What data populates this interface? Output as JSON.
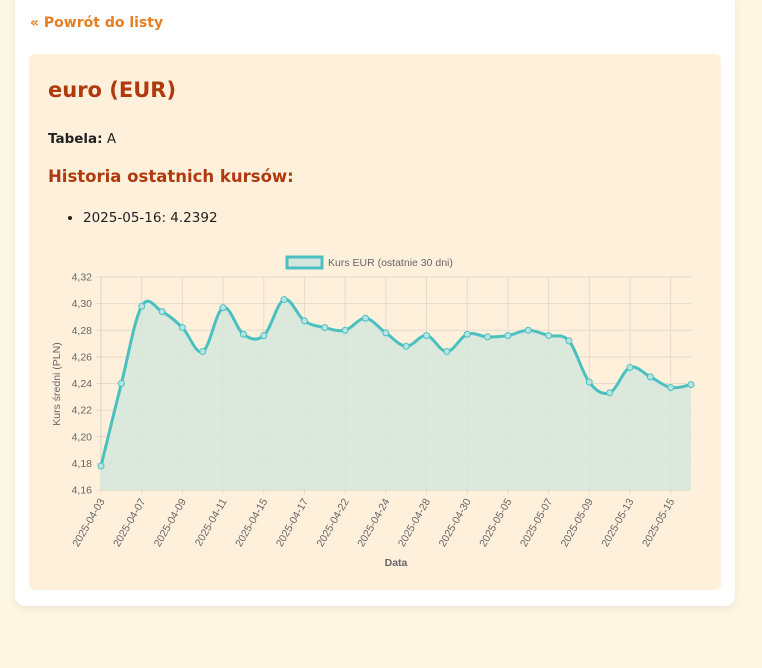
{
  "nav": {
    "back_label": "« Powrót do listy"
  },
  "currency": {
    "title": "euro (EUR)",
    "table_label": "Tabela:",
    "table_value": "A"
  },
  "history": {
    "title": "Historia ostatnich kursów:",
    "items": [
      "2025-05-16: 4.2392"
    ]
  },
  "colors": {
    "line": "#4bc0c0",
    "fill": "#d5e6dc",
    "accent": "#b03a0e",
    "link": "#e67e22"
  },
  "chart_data": {
    "type": "line",
    "title": "",
    "legend": "top",
    "grid": true,
    "xlabel": "Data",
    "ylabel": "Kurs średni (PLN)",
    "ylim": [
      4.16,
      4.32
    ],
    "yticks": [
      "4,32",
      "4,30",
      "4,28",
      "4,26",
      "4,24",
      "4,22",
      "4,20",
      "4,18",
      "4,16"
    ],
    "x": [
      "2025-04-03",
      "2025-04-04",
      "2025-04-07",
      "2025-04-08",
      "2025-04-09",
      "2025-04-10",
      "2025-04-11",
      "2025-04-14",
      "2025-04-15",
      "2025-04-16",
      "2025-04-17",
      "2025-04-18",
      "2025-04-22",
      "2025-04-23",
      "2025-04-24",
      "2025-04-25",
      "2025-04-28",
      "2025-04-29",
      "2025-04-30",
      "2025-05-02",
      "2025-05-05",
      "2025-05-06",
      "2025-05-07",
      "2025-05-08",
      "2025-05-09",
      "2025-05-12",
      "2025-05-13",
      "2025-05-14",
      "2025-05-15",
      "2025-05-16"
    ],
    "xtick_labels": [
      "2025-04-03",
      "2025-04-07",
      "2025-04-09",
      "2025-04-11",
      "2025-04-15",
      "2025-04-17",
      "2025-04-22",
      "2025-04-24",
      "2025-04-28",
      "2025-04-30",
      "2025-05-05",
      "2025-05-07",
      "2025-05-09",
      "2025-05-13",
      "2025-05-15"
    ],
    "series": [
      {
        "name": "Kurs EUR (ostatnie 30 dni)",
        "values": [
          4.178,
          4.24,
          4.298,
          4.294,
          4.282,
          4.264,
          4.297,
          4.277,
          4.276,
          4.303,
          4.287,
          4.282,
          4.28,
          4.289,
          4.278,
          4.268,
          4.276,
          4.264,
          4.277,
          4.275,
          4.276,
          4.28,
          4.276,
          4.272,
          4.241,
          4.233,
          4.252,
          4.245,
          4.237,
          4.2392
        ]
      }
    ]
  }
}
